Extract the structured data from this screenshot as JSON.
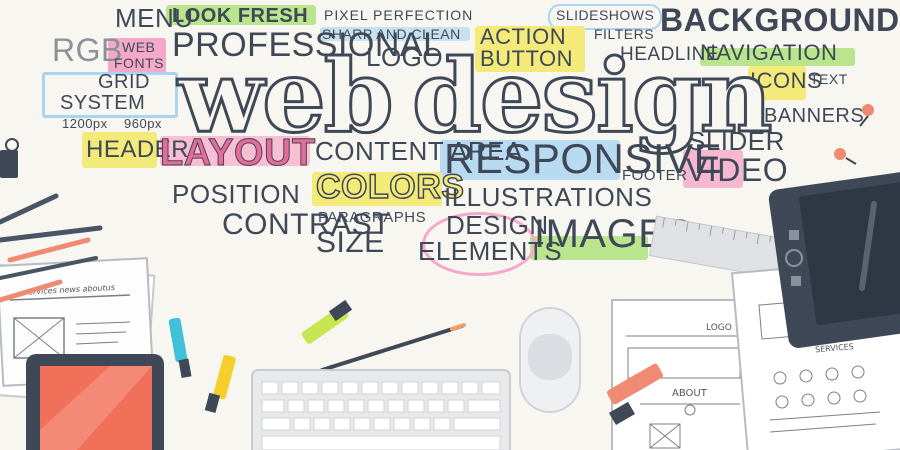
{
  "title_words": {
    "web": "web",
    "design": "design"
  },
  "words": {
    "menu": "MENU",
    "look_fresh": "LOOK FRESH",
    "pixel_perfection": "PIXEL PERFECTION",
    "slideshows": "SLIDESHOWS",
    "background": "BACKGROUND",
    "rgb": "RGB",
    "web_fonts_1": "WEB",
    "web_fonts_2": "FONTS",
    "professional": "PROFESSIONAL",
    "sharp_and_clean": "SHARP AND CLEAN",
    "action": "ACTION",
    "button": "BUTTON",
    "filters": "FILTERS",
    "headline": "HEADLINE",
    "navigation": "NAVIGATION",
    "logo": "LOGO",
    "grid": "GRID",
    "system": "SYSTEM",
    "px1200": "1200px",
    "px960": "960px",
    "icons": "ICONS",
    "text": "TEXT",
    "banners": "BANNERS",
    "header": "HEADER",
    "layout": "LAYOUT",
    "content_area": "CONTENT AREA",
    "responsive": "RESPONSIVE",
    "slider": "SLIDER",
    "footer": "FOOTER",
    "video": "VIDEO",
    "position": "POSITION",
    "colors": "COLORS",
    "illustrations": "ILLUSTRATIONS",
    "contrast": "CONTRAST",
    "paragraphs": "PARAGRAPHS",
    "size": "SIZE",
    "design_elements_1": "DESIGN",
    "design_elements_2": "ELEMENTS",
    "images": "IMAGES"
  },
  "sketch_labels": {
    "services_left": "services   news   aboutus",
    "about": "ABOUT",
    "logo_sketch": "LOGO",
    "services_right": "SERVICES"
  },
  "colors": {
    "background": "#f8f6f1",
    "text": "#3f4856",
    "highlight_green": "#b9e58c",
    "highlight_yellow": "#f4ea7a",
    "highlight_pink": "#f5a8c8",
    "highlight_blue": "#a9d4f2",
    "marker_cyan": "#3fc2d8",
    "marker_yellow": "#f6cf2c",
    "marker_lime": "#c8e651",
    "marker_salmon": "#f08a72",
    "tablet_screen": "#f0705a"
  }
}
